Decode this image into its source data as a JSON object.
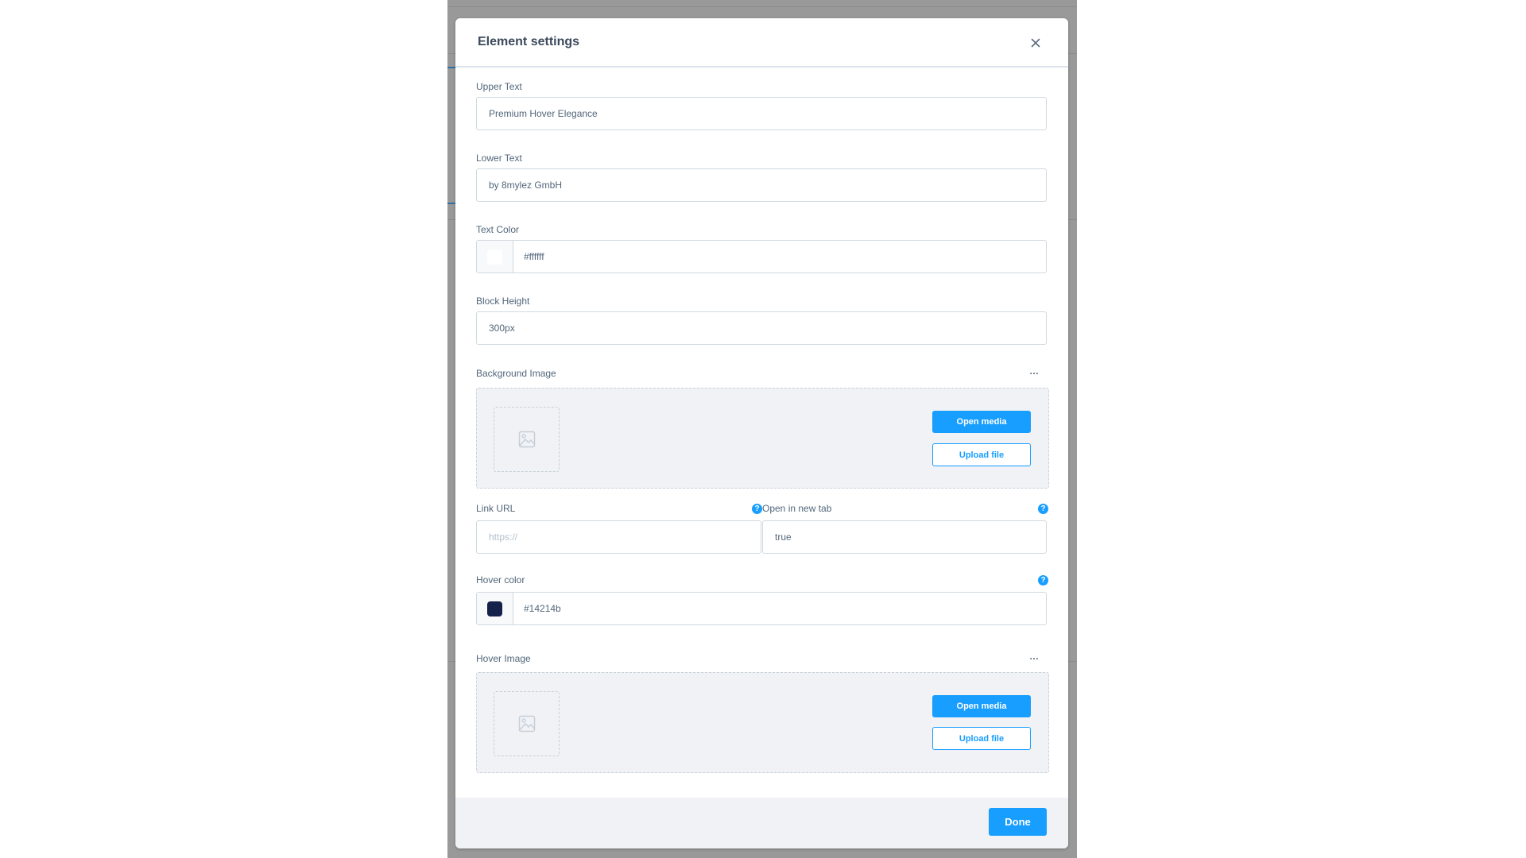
{
  "modal": {
    "title": "Element settings",
    "close_icon": "close-icon"
  },
  "fields": {
    "upper_text": {
      "label": "Upper Text",
      "value": "Premium Hover Elegance"
    },
    "lower_text": {
      "label": "Lower Text",
      "value": "by 8mylez GmbH"
    },
    "text_color": {
      "label": "Text Color",
      "value": "#ffffff",
      "swatch": "#ffffff"
    },
    "block_height": {
      "label": "Block Height",
      "value": "300px"
    },
    "background_image": {
      "label": "Background Image",
      "menu_icon": "ellipsis-icon",
      "placeholder_icon": "image-icon",
      "open_media": "Open media",
      "upload_file": "Upload file"
    },
    "link_url": {
      "label": "Link URL",
      "value": "",
      "placeholder": "https://",
      "help_icon": "help-icon"
    },
    "open_new_tab": {
      "label": "Open in new tab",
      "value": "true",
      "help_icon": "help-icon"
    },
    "hover_color": {
      "label": "Hover color",
      "value": "#14214b",
      "swatch": "#14214b",
      "help_icon": "help-icon"
    },
    "hover_image": {
      "label": "Hover Image",
      "menu_icon": "ellipsis-icon",
      "placeholder_icon": "image-icon",
      "open_media": "Open media",
      "upload_file": "Upload file"
    }
  },
  "footer": {
    "done_label": "Done"
  },
  "colors": {
    "accent": "#189eff",
    "title_text": "#3c4a5c",
    "label_text": "#52667a",
    "backdrop": "#999999"
  },
  "glyphs": {
    "ellipsis": "…",
    "help": "?"
  }
}
